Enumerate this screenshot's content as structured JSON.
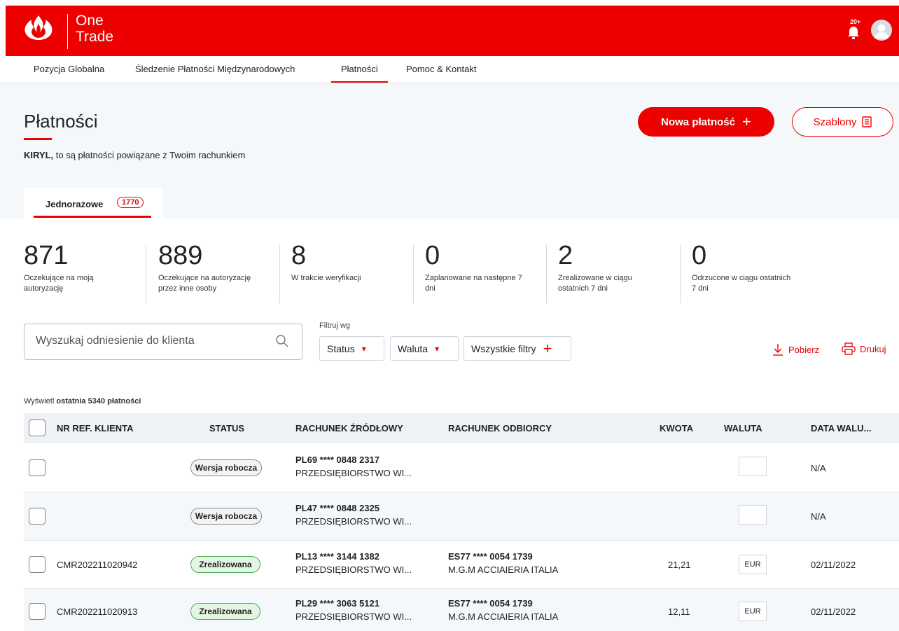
{
  "brand": {
    "line1": "One",
    "line2": "Trade",
    "notification_count": "20+"
  },
  "nav": {
    "items": [
      "Pozycja Globalna",
      "Śledzenie Płatności Międzynarodowych",
      "Płatności",
      "Pomoc & Kontakt"
    ],
    "active": "Płatności"
  },
  "page": {
    "title": "Płatności",
    "subtitle_name": "KIRYL,",
    "subtitle_text": " to są płatności powiązane z Twoim rachunkiem",
    "new_payment_label": "Nowa płatność",
    "new_payment_icon": "+",
    "templates_label": "Szablony"
  },
  "tab": {
    "label": "Jednorazowe",
    "count": "1770"
  },
  "stats": [
    {
      "value": "871",
      "label": "Oczekujące na moją autoryzację"
    },
    {
      "value": "889",
      "label": "Oczekujące na autoryzację przez inne osoby"
    },
    {
      "value": "8",
      "label": "W trakcie weryfikacji"
    },
    {
      "value": "0",
      "label": "Zaplanowane na następne 7 dni"
    },
    {
      "value": "2",
      "label": "Zrealizowane w ciągu ostatnich 7 dni"
    },
    {
      "value": "0",
      "label": "Odrzucone w ciągu ostatnich 7 dni"
    }
  ],
  "search": {
    "placeholder": "Wyszukaj odniesienie do klienta"
  },
  "filters": {
    "label": "Filtruj wg",
    "status": "Status",
    "currency": "Waluta",
    "all": "Wszystkie filtry"
  },
  "actions": {
    "download": "Pobierz",
    "print": "Drukuj"
  },
  "table": {
    "showing_prefix": "Wyświetl ",
    "showing_bold": "ostatnia 5340 płatności",
    "columns": [
      "NR REF. KLIENTA",
      "STATUS",
      "RACHUNEK ŹRÓDŁOWY",
      "RACHUNEK ODBIORCY",
      "KWOTA",
      "WALUTA",
      "DATA WALU..."
    ],
    "rows": [
      {
        "ref": "",
        "status": "Wersja robocza",
        "status_type": "draft",
        "src_acct": "PL69 **** 0848 2317",
        "src_name": "PRZEDSIĘBIORSTWO WI...",
        "dst_acct": "",
        "dst_name": "",
        "amount": "",
        "currency": "",
        "date": "N/A"
      },
      {
        "ref": "",
        "status": "Wersja robocza",
        "status_type": "draft",
        "src_acct": "PL47 **** 0848 2325",
        "src_name": "PRZEDSIĘBIORSTWO WI...",
        "dst_acct": "",
        "dst_name": "",
        "amount": "",
        "currency": "",
        "date": "N/A"
      },
      {
        "ref": "CMR202211020942",
        "status": "Zrealizowana",
        "status_type": "done",
        "src_acct": "PL13 **** 3144 1382",
        "src_name": "PRZEDSIĘBIORSTWO WI...",
        "dst_acct": "ES77 **** 0054 1739",
        "dst_name": "M.G.M ACCIAIERIA ITALIA",
        "amount": "21,21",
        "currency": "EUR",
        "date": "02/11/2022"
      },
      {
        "ref": "CMR202211020913",
        "status": "Zrealizowana",
        "status_type": "done",
        "src_acct": "PL29 **** 3063 5121",
        "src_name": "PRZEDSIĘBIORSTWO WI...",
        "dst_acct": "ES77 **** 0054 1739",
        "dst_name": "M.G.M ACCIAIERIA ITALIA",
        "amount": "12,11",
        "currency": "EUR",
        "date": "02/11/2022"
      }
    ]
  },
  "colors": {
    "brand_red": "#ec0000",
    "done_green": "#4caf50"
  }
}
